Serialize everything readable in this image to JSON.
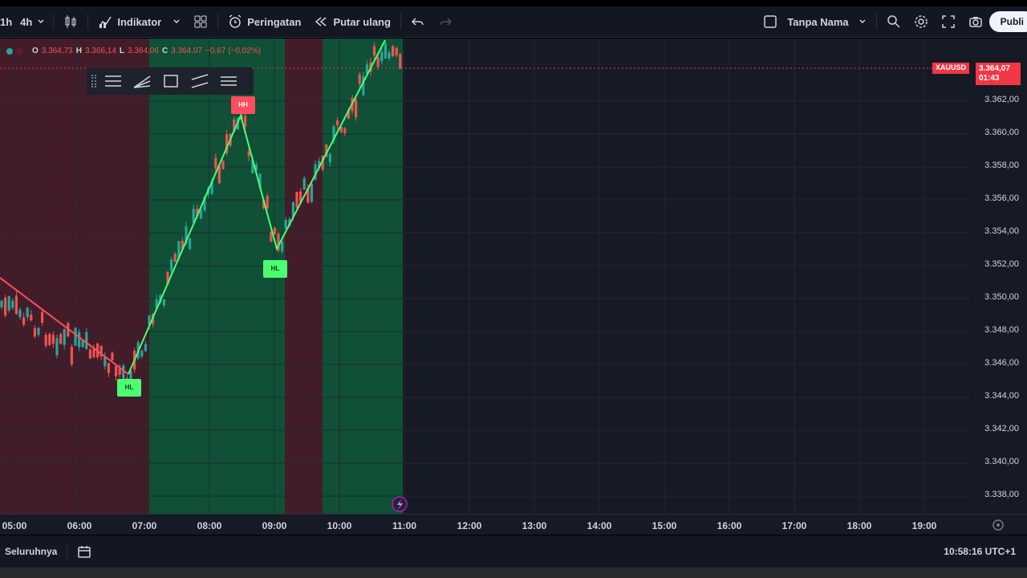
{
  "toolbar": {
    "timeframes": [
      "1h",
      "4h"
    ],
    "indicator_label": "Indikator",
    "alert_label": "Peringatan",
    "replay_label": "Putar ulang",
    "layout_name": "Tanpa Nama",
    "publish_label": "Publi"
  },
  "legend": {
    "o_label": "O",
    "o_value": "3.364,73",
    "h_label": "H",
    "h_value": "3.366,14",
    "l_label": "L",
    "l_value": "3.364,06",
    "c_label": "C",
    "c_value": "3.364,07",
    "change": "−0,67 (−0,02%)"
  },
  "price_axis": {
    "labels": [
      "3.362,00",
      "3.360,00",
      "3.358,00",
      "3.356,00",
      "3.354,00",
      "3.352,00",
      "3.350,00",
      "3.348,00",
      "3.346,00",
      "3.344,00",
      "3.342,00",
      "3.340,00",
      "3.338,00"
    ],
    "current_price": "3.364,07",
    "countdown": "01:43",
    "symbol": "XAUUSD"
  },
  "time_axis": {
    "labels": [
      "05:00",
      "06:00",
      "07:00",
      "08:00",
      "09:00",
      "10:00",
      "11:00",
      "12:00",
      "13:00",
      "14:00",
      "15:00",
      "16:00",
      "17:00",
      "18:00",
      "19:00"
    ]
  },
  "swing_labels": {
    "hh": "HH",
    "hl1": "HL",
    "hl2": "HL"
  },
  "bottom": {
    "range_label": "Seluruhnya",
    "clock": "10:58:16 UTC+1"
  },
  "colors": {
    "bull": "#26a69a",
    "bear": "#ef5350",
    "zone_bull": "#0e5a3a",
    "zone_bear": "#4a1f2a",
    "swing_line_up": "#4cff70",
    "swing_line_down": "#ff4d5e",
    "price_tag": "#f23645"
  }
}
